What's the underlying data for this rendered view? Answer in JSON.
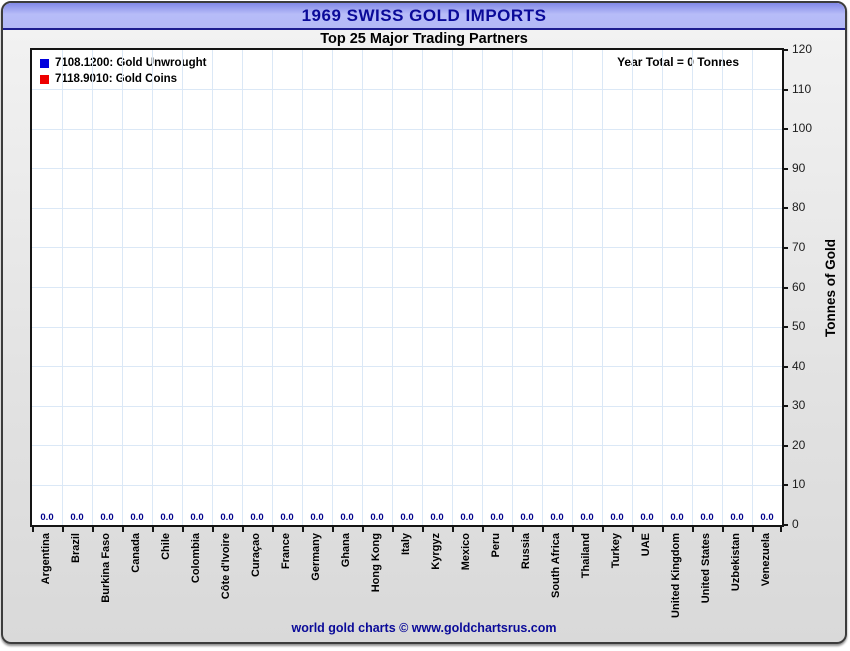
{
  "header": {
    "title": "1969 SWISS GOLD IMPORTS",
    "subtitle": "Top 25 Major Trading Partners"
  },
  "annotation": {
    "year_total": "Year Total = 0 Tonnes"
  },
  "footer": {
    "credit": "world gold charts © www.goldchartsrus.com"
  },
  "chart_data": {
    "type": "bar",
    "title": "1969 SWISS GOLD IMPORTS",
    "subtitle": "Top 25 Major Trading Partners",
    "categories": [
      "Argentina",
      "Brazil",
      "Burkina Faso",
      "Canada",
      "Chile",
      "Colombia",
      "Côte d'Ivoire",
      "Curaçao",
      "France",
      "Germany",
      "Ghana",
      "Hong Kong",
      "Italy",
      "Kyrgyz",
      "Mexico",
      "Peru",
      "Russia",
      "South Africa",
      "Thailand",
      "Turkey",
      "UAE",
      "United Kingdom",
      "United States",
      "Uzbekistan",
      "Venezuela"
    ],
    "series": [
      {
        "name": "7108.1200: Gold Unwrought",
        "color": "#0000dd",
        "values": [
          0,
          0,
          0,
          0,
          0,
          0,
          0,
          0,
          0,
          0,
          0,
          0,
          0,
          0,
          0,
          0,
          0,
          0,
          0,
          0,
          0,
          0,
          0,
          0,
          0
        ]
      },
      {
        "name": "7118.9010: Gold Coins",
        "color": "#ee0000",
        "values": [
          0,
          0,
          0,
          0,
          0,
          0,
          0,
          0,
          0,
          0,
          0,
          0,
          0,
          0,
          0,
          0,
          0,
          0,
          0,
          0,
          0,
          0,
          0,
          0,
          0
        ]
      }
    ],
    "value_label_format": "0.0",
    "value_label_color": "#00008b",
    "xlabel": "",
    "ylabel": "Tonnes of Gold",
    "ylim": [
      0,
      120
    ],
    "ytick_step": 10,
    "grid": true,
    "grid_color": "#dbe8f6",
    "legend_position": "top-left"
  }
}
